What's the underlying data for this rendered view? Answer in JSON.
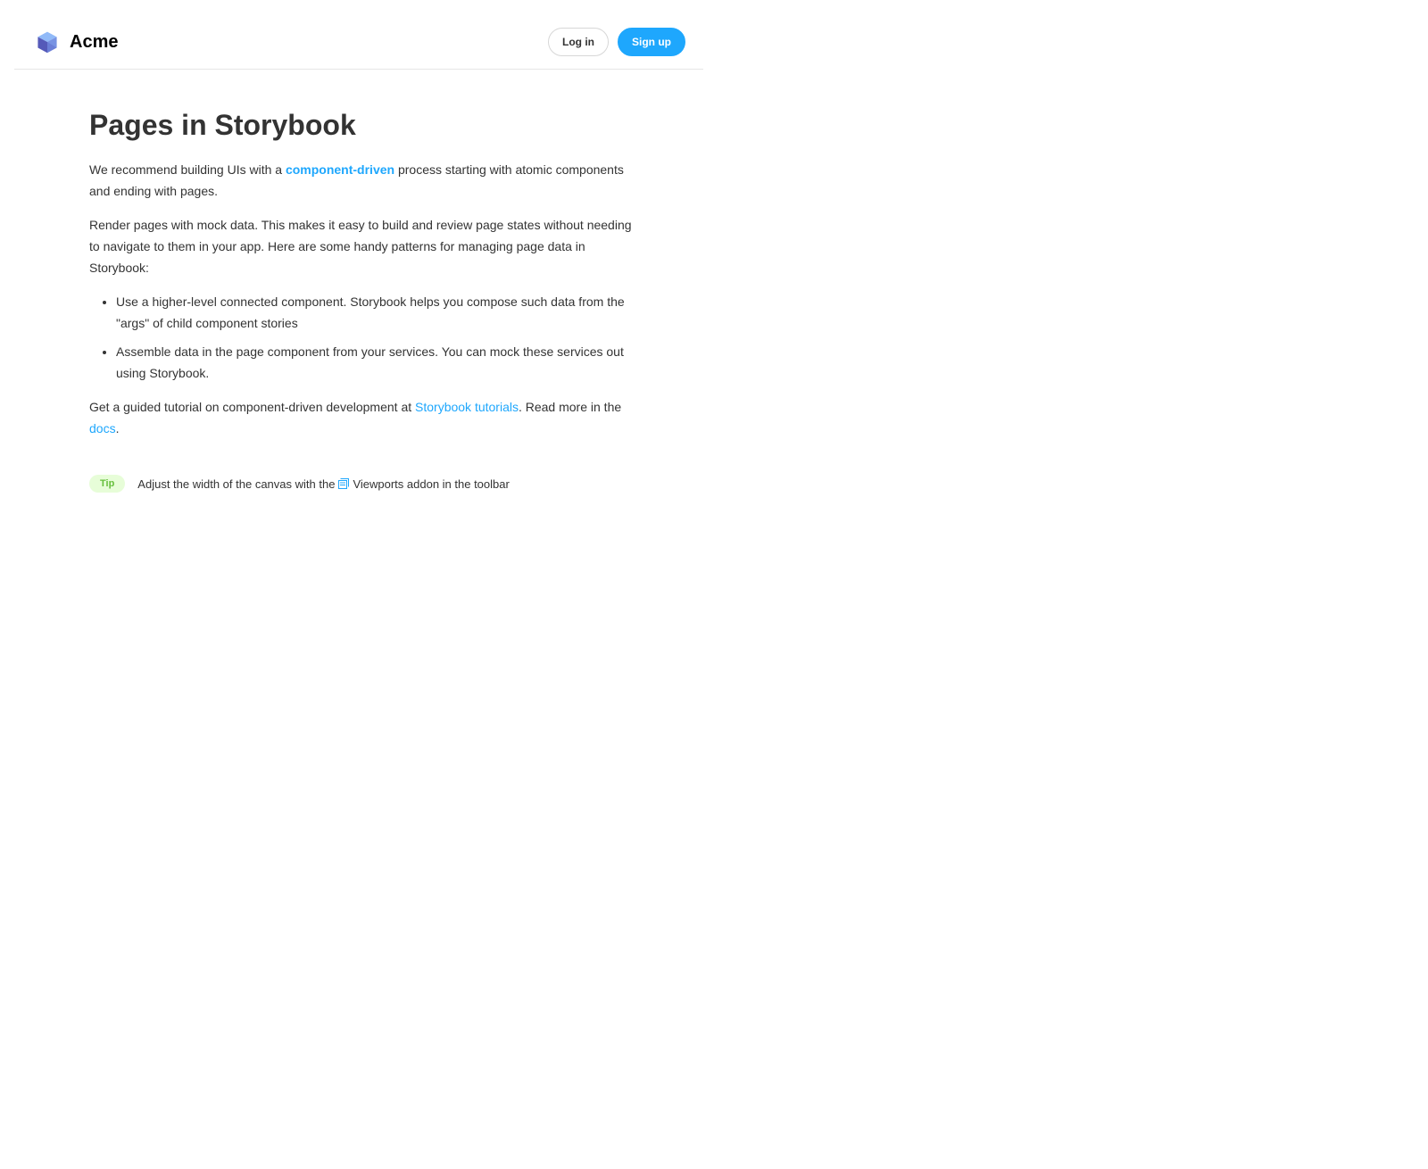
{
  "header": {
    "brand": "Acme",
    "logo_icon": "acme-cube-logo-icon",
    "login_label": "Log in",
    "signup_label": "Sign up"
  },
  "article": {
    "title": "Pages in Storybook",
    "p1": {
      "before": "We recommend building UIs with a ",
      "link": "component-driven",
      "after": " process starting with atomic components and ending with pages."
    },
    "p2": "Render pages with mock data. This makes it easy to build and review page states without needing to navigate to them in your app. Here are some handy patterns for managing page data in Storybook:",
    "bullets": [
      "Use a higher-level connected component. Storybook helps you compose such data from the \"args\" of child component stories",
      "Assemble data in the page component from your services. You can mock these services out using Storybook."
    ],
    "p3": {
      "before": "Get a guided tutorial on component-driven development at ",
      "link1": "Storybook tutorials",
      "middle": ". Read more in the ",
      "link2": "docs",
      "after": "."
    }
  },
  "tip": {
    "badge": "Tip",
    "before": "Adjust the width of the canvas with the ",
    "icon": "viewport-icon",
    "after": "Viewports addon in the toolbar"
  },
  "colors": {
    "accent": "#1ea7fd",
    "text": "#333333",
    "tip_bg": "#e7fdd8",
    "tip_text": "#66bf3c",
    "logo_light": "#91baf8",
    "logo_mid": "#6b7fd7",
    "logo_dark": "#555ab9"
  }
}
